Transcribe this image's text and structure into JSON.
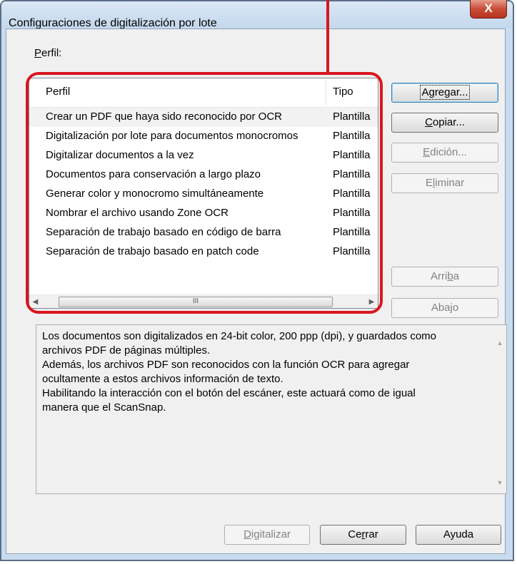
{
  "window": {
    "title": "Configuraciones de digitalización por lote",
    "close_label": "X"
  },
  "profile_label": {
    "mnemonic": "P",
    "rest": "erfil:"
  },
  "list": {
    "headers": [
      "Perfil",
      "Tipo"
    ],
    "rows": [
      {
        "perfil": "Crear un PDF que haya sido reconocido por OCR",
        "tipo": "Plantilla"
      },
      {
        "perfil": "Digitalización por lote para documentos monocromos",
        "tipo": "Plantilla"
      },
      {
        "perfil": "Digitalizar documentos a la vez",
        "tipo": "Plantilla"
      },
      {
        "perfil": "Documentos para conservación a largo plazo",
        "tipo": "Plantilla"
      },
      {
        "perfil": "Generar color y monocromo simultáneamente",
        "tipo": "Plantilla"
      },
      {
        "perfil": "Nombrar el archivo usando Zone OCR",
        "tipo": "Plantilla"
      },
      {
        "perfil": "Separación de trabajo basado en código de barra",
        "tipo": "Plantilla"
      },
      {
        "perfil": "Separación de trabajo basado en patch code",
        "tipo": "Plantilla"
      }
    ],
    "scroll_thumb_glyph": "III"
  },
  "buttons": {
    "agregar": "Agregar...",
    "copiar": {
      "mnemonic": "C",
      "rest": "opiar..."
    },
    "edicion": {
      "mnemonic": "E",
      "rest": "dición..."
    },
    "eliminar": {
      "pre": "E",
      "mnemonic": "l",
      "rest": "iminar"
    },
    "arriba": {
      "pre": "Arri",
      "mnemonic": "b",
      "rest": "a"
    },
    "abajo": "Abajo",
    "digitalizar": {
      "mnemonic": "D",
      "rest": "igitalizar"
    },
    "cerrar": {
      "pre": "Ce",
      "mnemonic": "r",
      "rest": "rar"
    },
    "ayuda": "Ayuda"
  },
  "description": {
    "lines": [
      "Los documentos son digitalizados en 24-bit color, 200 ppp (dpi), y guardados como",
      "archivos PDF de páginas múltiples.",
      "Además, los archivos PDF son reconocidos con la función OCR para agregar",
      "ocultamente a estos archivos información de texto.",
      "Habilitando la interacción con el botón del escáner, este actuará como de igual",
      "manera que el ScanSnap."
    ]
  },
  "colors": {
    "highlight": "#d9161f",
    "close_button": "#c9503a"
  }
}
